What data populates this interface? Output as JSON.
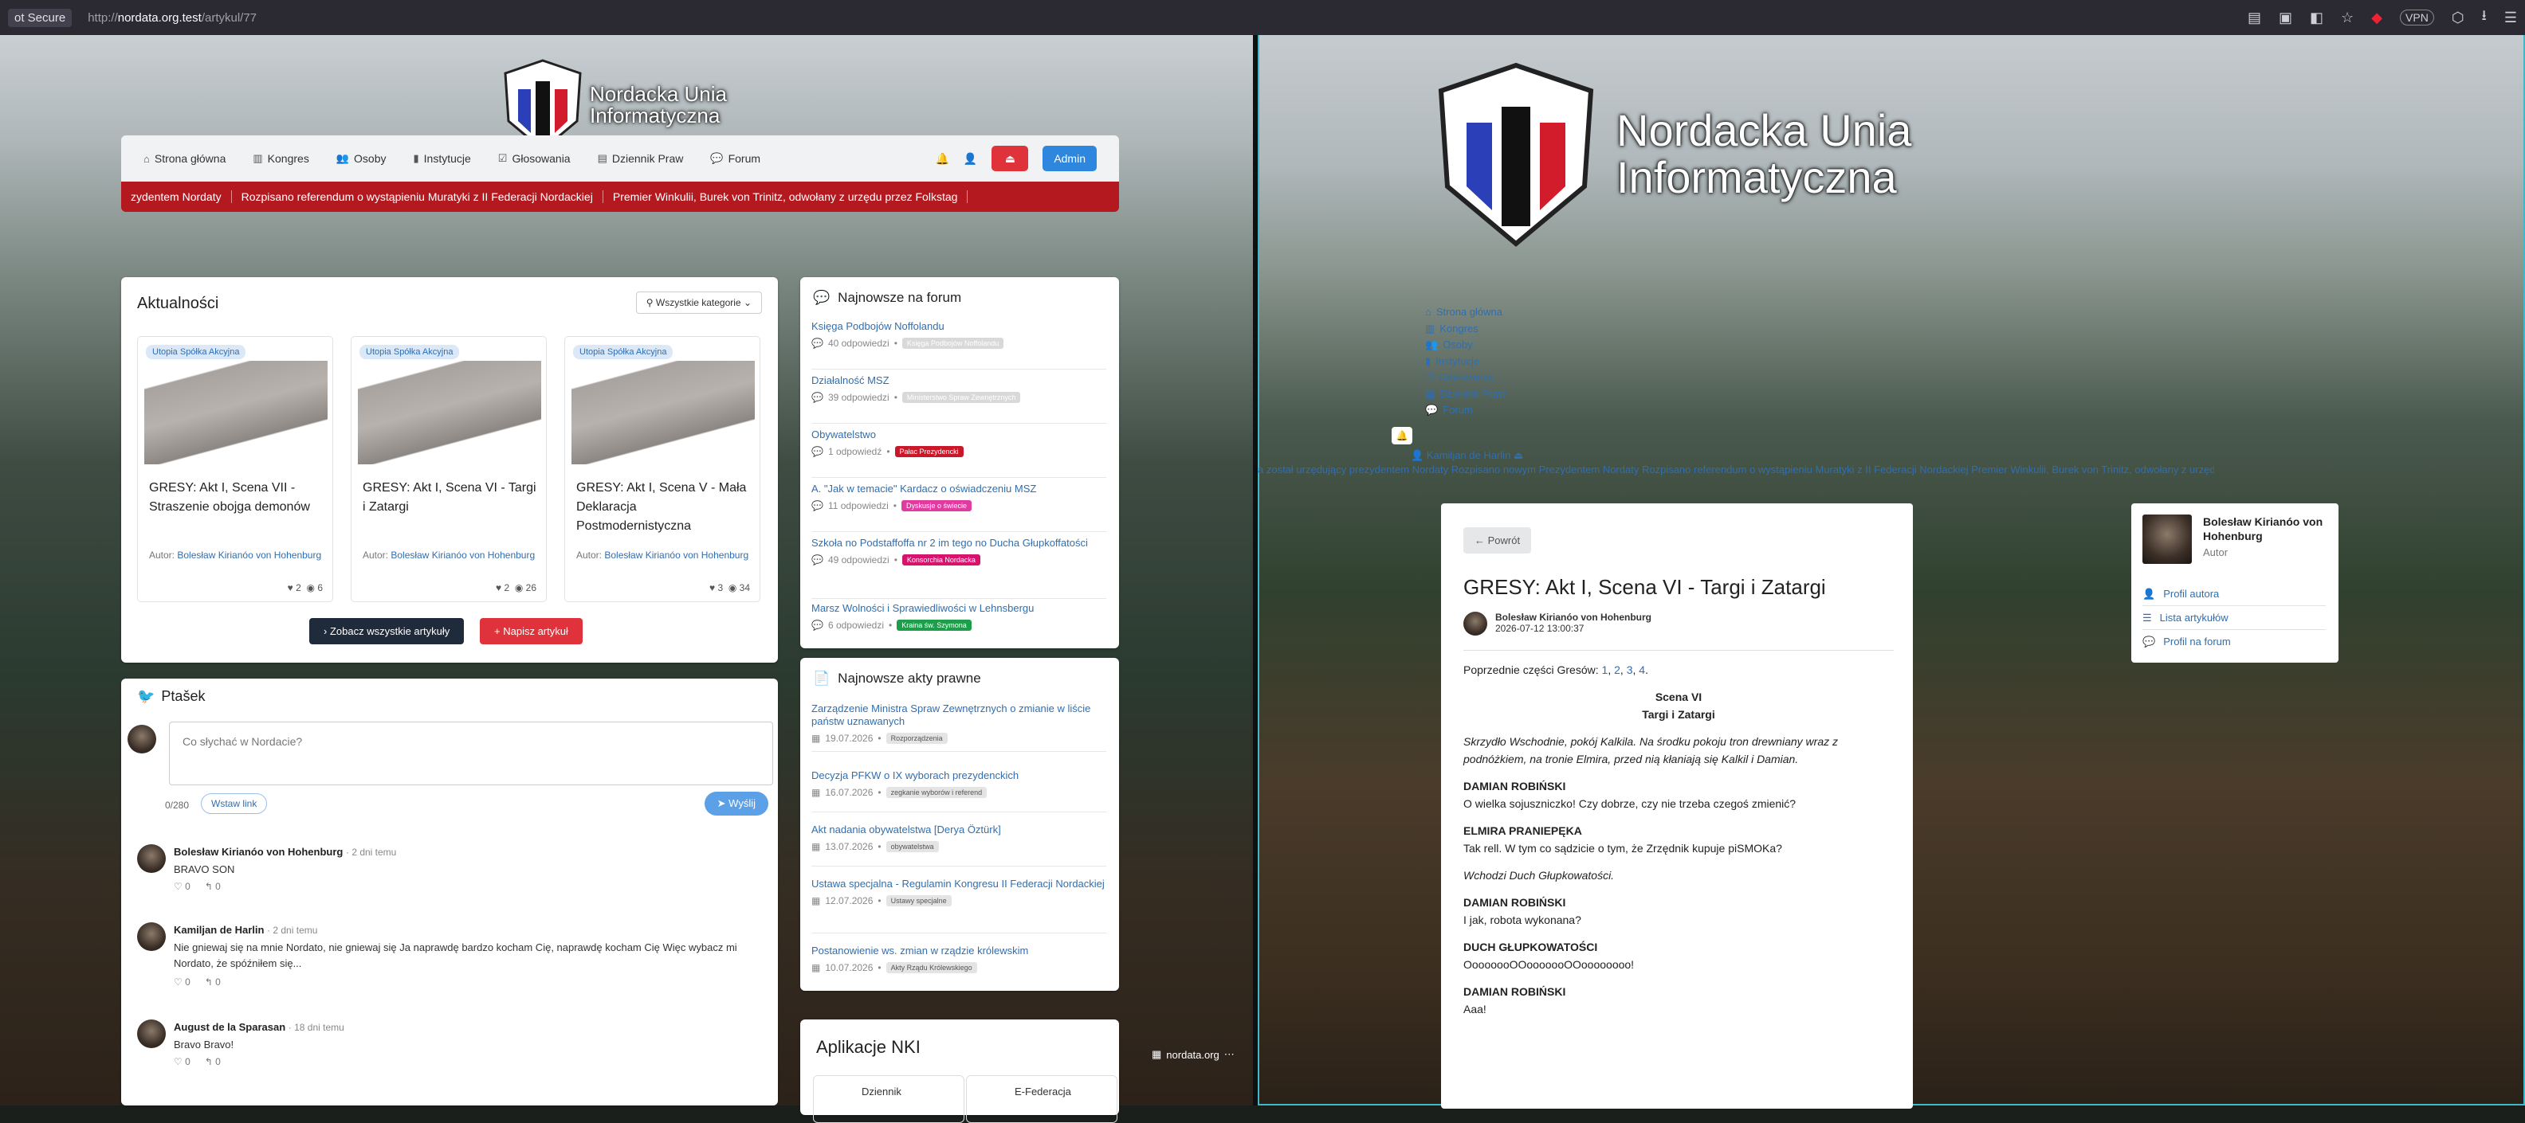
{
  "browser": {
    "security": "ot Secure",
    "url_prefix": "http://",
    "url_host": "nordata.org.test",
    "url_path": "/artykul/77",
    "vpn": "VPN"
  },
  "site": {
    "logo_line1": "Nordacka Unia",
    "logo_line2": "Informatyczna"
  },
  "nav": {
    "items": [
      "Strona główna",
      "Kongres",
      "Osoby",
      "Instytucje",
      "Głosowania",
      "Dziennik Praw",
      "Forum"
    ],
    "admin": "Admin"
  },
  "ticker": [
    "zydentem Nordaty",
    "Rozpisano referendum o wystąpieniu Muratyki z II Federacji Nordackiej",
    "Premier Winkulii, Burek von Trinitz, odwołany z urzędu przez Folkstag"
  ],
  "news": {
    "title": "Aktualności",
    "filter": "Wszystkie kategorie",
    "all_articles": "Zobacz wszystkie artykuły",
    "write": "Napisz artykuł",
    "author_label": "Autor:",
    "articles": [
      {
        "badge": "Utopia Spółka Akcyjna",
        "title": "GRESY: Akt I, Scena VII - Straszenie obojga demonów",
        "author": "Bolesław Kirianóo von Hohenburg",
        "likes": "2",
        "views": "6"
      },
      {
        "badge": "Utopia Spółka Akcyjna",
        "title": "GRESY: Akt I, Scena VI - Targi i Zatargi",
        "author": "Bolesław Kirianóo von Hohenburg",
        "likes": "2",
        "views": "26"
      },
      {
        "badge": "Utopia Spółka Akcyjna",
        "title": "GRESY: Akt I, Scena V - Mała Deklaracja Postmodernistyczna",
        "author": "Bolesław Kirianóo von Hohenburg",
        "likes": "3",
        "views": "34"
      }
    ]
  },
  "ptasek": {
    "title": "Ptašek",
    "placeholder": "Co słychać w Nordacie?",
    "counter": "0/280",
    "link": "Wstaw link",
    "send": "Wyślij",
    "posts": [
      {
        "name": "Bolesław Kirianóo von Hohenburg",
        "time": "· 2 dni temu",
        "text": "BRAVO SON",
        "likes": "0",
        "replies": "0"
      },
      {
        "name": "Kamiljan de Harlin",
        "time": "· 2 dni temu",
        "text": "Nie gniewaj się na mnie Nordato, nie gniewaj się Ja naprawdę bardzo kocham Cię, naprawdę kocham Cię Więc wybacz mi Nordato, że spóźniłem się...",
        "likes": "0",
        "replies": "0"
      },
      {
        "name": "August de la Sparasan",
        "time": "· 18 dni temu",
        "text": "Bravo Bravo!",
        "likes": "0",
        "replies": "0"
      }
    ]
  },
  "forum": {
    "title": "Najnowsze na forum",
    "items": [
      {
        "title": "Księga Podbojów Noffolandu",
        "count": "40 odpowiedzi",
        "tag": "Księga Podbojów Noffolandu",
        "color": "#d9d9d9"
      },
      {
        "title": "Działalność MSZ",
        "count": "39 odpowiedzi",
        "tag": "Ministerstwo Spraw Zewnętrznych",
        "color": "#d9d9d9"
      },
      {
        "title": "Obywatelstwo",
        "count": "1 odpowiedź",
        "tag": "Pałac Prezydencki",
        "color": "#c9182a"
      },
      {
        "title": "A. \"Jak w temacie\" Kardacz o oświadczeniu MSZ",
        "count": "11 odpowiedzi",
        "tag": "Dyskusje o świecie",
        "color": "#e23b9f"
      },
      {
        "title": "Szkoła no Podstaffoffa nr 2 im tego no Ducha Głupkoffatości",
        "count": "49 odpowiedzi",
        "tag": "Konsorchia Nordacka",
        "color": "#d6146e"
      },
      {
        "title": "Marsz Wolności i Sprawiedliwości w Lehnsbergu",
        "count": "6 odpowiedzi",
        "tag": "Kraina św. Szymona",
        "color": "#1d9e4a"
      }
    ]
  },
  "laws": {
    "title": "Najnowsze akty prawne",
    "items": [
      {
        "title": "Zarządzenie Ministra Spraw Zewnętrznych o zmianie w liście państw uznawanych",
        "date": "19.07.2026",
        "tag": "Rozporządzenia"
      },
      {
        "title": "Decyzja PFKW o IX wyborach prezydenckich",
        "date": "16.07.2026",
        "tag": "zegkanie wyborów i referend"
      },
      {
        "title": "Akt nadania obywatelstwa [Derya Öztürk]",
        "date": "13.07.2026",
        "tag": "obywatelstwa"
      },
      {
        "title": "Ustawa specjalna - Regulamin Kongresu II Federacji Nordackiej",
        "date": "12.07.2026",
        "tag": "Ustawy specjalne"
      },
      {
        "title": "Postanowienie ws. zmian w rządzie królewskim",
        "date": "10.07.2026",
        "tag": "Akty Rządu Królewskiego"
      }
    ]
  },
  "apps": {
    "title": "Aplikacje NKI",
    "items": [
      "Dziennik",
      "E-Federacja"
    ]
  },
  "status": {
    "host": "nordata.org"
  },
  "right": {
    "ticker": "a został urzędujący prezydentem Nordaty   Rozpisano nowym Prezydentem Nordaty   Rozpisano referendum o wystąpieniu Muratyki z II Federacji Nordackiej   Premier Winkulii, Burek von Trinitz, odwołany z urzędu przez Folkstag",
    "user": "Kamiljan de Harlin",
    "article": {
      "back": "← Powrót",
      "title": "GRESY: Akt I, Scena VI - Targi i Zatargi",
      "author": "Bolesław Kirianóo von Hohenburg",
      "date": "2026-07-12 13:00:37",
      "prev_intro": "Poprzednie części Gresów:",
      "prev_links": [
        "1",
        "2",
        "3",
        "4"
      ],
      "scene": "Scena VI",
      "scene_title": "Targi i Zatargi",
      "stage": "Skrzydło Wschodnie, pokój Kalkila. Na środku pokoju tron drewniany wraz z podnóżkiem, na tronie Elmira, przed nią kłaniają się Kalkil i Damian.",
      "lines": [
        {
          "who": "DAMIAN ROBIŃSKI",
          "say": "O wielka sojuszniczko! Czy dobrze, czy nie trzeba czegoś zmienić?"
        },
        {
          "who": "ELMIRA PRANIEPĘKA",
          "say": "Tak rell. W tym co sądzicie o tym, że Zrzędnik kupuje piSMOKa?"
        }
      ],
      "stage2": "Wchodzi Duch Głupkowatości.",
      "lines2": [
        {
          "who": "DAMIAN ROBIŃSKI",
          "say": "I jak, robota wykonana?"
        },
        {
          "who": "DUCH GŁUPKOWATOŚCI",
          "say": "OooooooOOooooooOOoooooooo!"
        },
        {
          "who": "DAMIAN ROBIŃSKI",
          "say": "Aaa!"
        }
      ]
    },
    "author_card": {
      "name": "Bolesław Kirianóo von Hohenburg",
      "role": "Autor",
      "links": [
        "Profil autora",
        "Lista artykułów",
        "Profil na forum"
      ]
    }
  }
}
